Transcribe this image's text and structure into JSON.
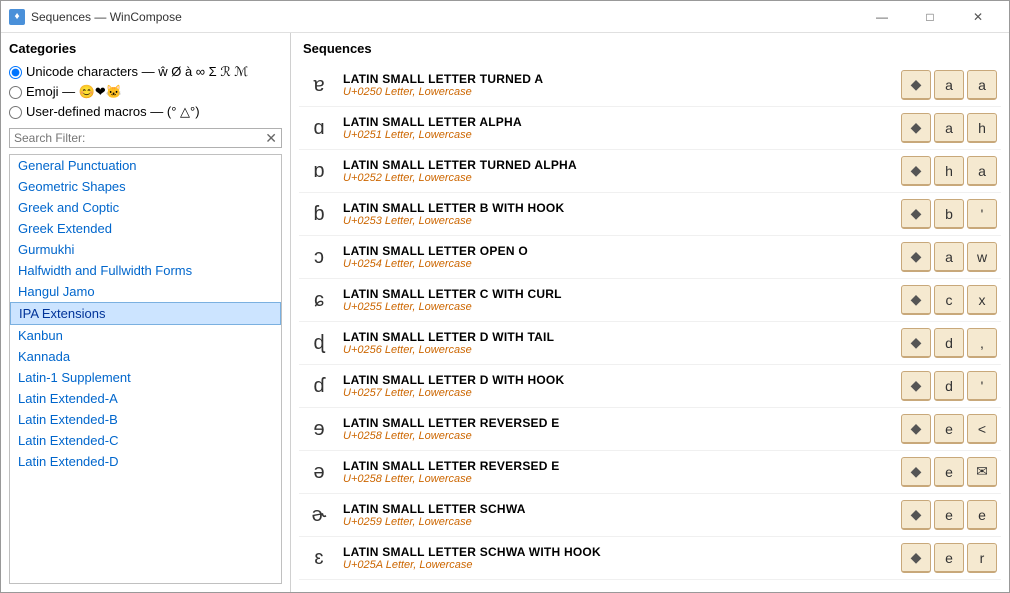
{
  "window": {
    "title": "Sequences — WinCompose",
    "icon": "♦"
  },
  "titlebar": {
    "minimize": "—",
    "maximize": "□",
    "close": "✕"
  },
  "leftPanel": {
    "categoriesLabel": "Categories",
    "radioOptions": [
      {
        "id": "unicode",
        "label": "Unicode characters — ",
        "suffix": "ŵ Ø à ∞ Σ ℛ ℳ",
        "checked": true
      },
      {
        "id": "emoji",
        "label": "Emoji — 😊❤🐱",
        "checked": false
      },
      {
        "id": "macros",
        "label": "User-defined macros — (° △°)",
        "checked": false
      }
    ],
    "searchPlaceholder": "Search Filter:",
    "searchValue": "",
    "categories": [
      {
        "id": "general-punctuation",
        "label": "General Punctuation",
        "selected": false
      },
      {
        "id": "geometric-shapes",
        "label": "Geometric Shapes",
        "selected": false
      },
      {
        "id": "greek-coptic",
        "label": "Greek and Coptic",
        "selected": false
      },
      {
        "id": "greek-extended",
        "label": "Greek Extended",
        "selected": false
      },
      {
        "id": "gurmukhi",
        "label": "Gurmukhi",
        "selected": false
      },
      {
        "id": "halfwidth-fullwidth",
        "label": "Halfwidth and Fullwidth Forms",
        "selected": false
      },
      {
        "id": "hangul-jamo",
        "label": "Hangul Jamo",
        "selected": false
      },
      {
        "id": "ipa-extensions",
        "label": "IPA Extensions",
        "selected": true
      },
      {
        "id": "kanbun",
        "label": "Kanbun",
        "selected": false
      },
      {
        "id": "kannada",
        "label": "Kannada",
        "selected": false
      },
      {
        "id": "latin-1-supplement",
        "label": "Latin-1 Supplement",
        "selected": false
      },
      {
        "id": "latin-extended-a",
        "label": "Latin Extended-A",
        "selected": false
      },
      {
        "id": "latin-extended-b",
        "label": "Latin Extended-B",
        "selected": false
      },
      {
        "id": "latin-extended-c",
        "label": "Latin Extended-C",
        "selected": false
      },
      {
        "id": "latin-extended-d",
        "label": "Latin Extended-D",
        "selected": false
      }
    ]
  },
  "rightPanel": {
    "label": "Sequences",
    "sequences": [
      {
        "char": "ɐ",
        "name": "LATIN SMALL LETTER TURNED A",
        "code": "U+0250",
        "type": "Letter, Lowercase",
        "keys": [
          "◆",
          "a",
          "a"
        ]
      },
      {
        "char": "ɑ",
        "name": "LATIN SMALL LETTER ALPHA",
        "code": "U+0251",
        "type": "Letter, Lowercase",
        "keys": [
          "◆",
          "a",
          "h"
        ]
      },
      {
        "char": "ɒ",
        "name": "LATIN SMALL LETTER TURNED ALPHA",
        "code": "U+0252",
        "type": "Letter, Lowercase",
        "keys": [
          "◆",
          "h",
          "a"
        ]
      },
      {
        "char": "ɓ",
        "name": "LATIN SMALL LETTER B WITH HOOK",
        "code": "U+0253",
        "type": "Letter, Lowercase",
        "keys": [
          "◆",
          "b",
          "'"
        ]
      },
      {
        "char": "ɔ",
        "name": "LATIN SMALL LETTER OPEN O",
        "code": "U+0254",
        "type": "Letter, Lowercase",
        "keys": [
          "◆",
          "a",
          "w"
        ]
      },
      {
        "char": "ɕ",
        "name": "LATIN SMALL LETTER C WITH CURL",
        "code": "U+0255",
        "type": "Letter, Lowercase",
        "keys": [
          "◆",
          "c",
          "x"
        ]
      },
      {
        "char": "ɖ",
        "name": "LATIN SMALL LETTER D WITH TAIL",
        "code": "U+0256",
        "type": "Letter, Lowercase",
        "keys": [
          "◆",
          "d",
          ","
        ]
      },
      {
        "char": "ɗ",
        "name": "LATIN SMALL LETTER D WITH HOOK",
        "code": "U+0257",
        "type": "Letter, Lowercase",
        "keys": [
          "◆",
          "d",
          "'"
        ]
      },
      {
        "char": "ɘ",
        "name": "LATIN SMALL LETTER REVERSED E",
        "code": "U+0258",
        "type": "Letter, Lowercase",
        "keys": [
          "◆",
          "e",
          "<"
        ]
      },
      {
        "char": "ə",
        "name": "LATIN SMALL LETTER REVERSED E",
        "code": "U+0258",
        "type": "Letter, Lowercase",
        "keys": [
          "◆",
          "e",
          "✉"
        ]
      },
      {
        "char": "ɚ",
        "name": "LATIN SMALL LETTER SCHWA",
        "code": "U+0259",
        "type": "Letter, Lowercase",
        "keys": [
          "◆",
          "e",
          "e"
        ]
      },
      {
        "char": "ɛ",
        "name": "LATIN SMALL LETTER SCHWA WITH HOOK",
        "code": "U+025A",
        "type": "Letter, Lowercase",
        "keys": [
          "◆",
          "e",
          "r"
        ]
      }
    ]
  }
}
